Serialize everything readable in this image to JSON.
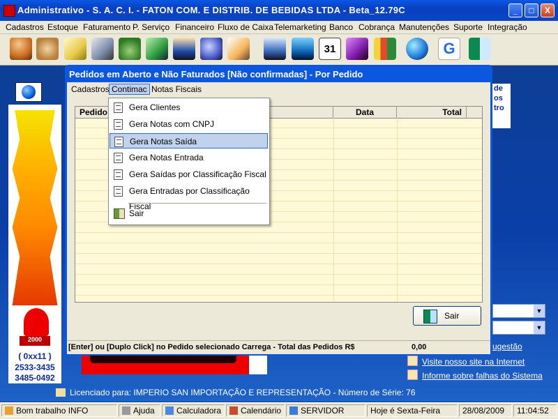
{
  "app": {
    "title": "Administrativo - S. A. C. I. - FATON COM. E DISTRIB. DE BEBIDAS LTDA - Beta_12.79C",
    "window_buttons": {
      "minimize": "_",
      "maximize": "□",
      "close": "X"
    }
  },
  "menubar": [
    "Cadastros",
    "Estoque",
    "Faturamento",
    "P. Serviço",
    "Financeiro",
    "Fluxo de Caixa",
    "Telemarketing",
    "Banco",
    "Cobrança",
    "Manutenções",
    "Suporte",
    "Integração"
  ],
  "toolbar": {
    "icons": [
      "users-icon",
      "handshake-icon",
      "notes-icon",
      "pen-icon",
      "money-bag-icon",
      "cash-icon",
      "person-icon",
      "gears-icon",
      "edit-icon",
      "terminal-icon",
      "calculator-icon",
      "calendar-icon",
      "book-icon",
      "bar-chart-icon",
      "globe-icon",
      "google-icon",
      "exit-door-icon"
    ],
    "calendar_day": "31"
  },
  "left_panel": {
    "phone_area": "( 0xx11 )",
    "phone1": "2533-3435",
    "phone2": "3485-0492",
    "badge": "2000"
  },
  "background": {
    "right_card_lines": [
      "de",
      "os",
      "",
      "tro"
    ],
    "right_links": [
      "ugestão",
      "Visite nosso site na Internet",
      "Informe sobre falhas do Sistema"
    ],
    "license": "Licenciado para: IMPERIO SAN IMPORTAÇÃO E REPRESENTAÇÃO - Número de Série: 76"
  },
  "child_window": {
    "title": "Pedidos em Aberto e Não Faturados [Não confirmadas] - Por Pedido",
    "menu": [
      "Cadastros",
      "Contimac",
      "Notas Fiscais"
    ],
    "grid_headers": {
      "pedido": "Pedido",
      "data": "Data",
      "total": "Total"
    },
    "sair_button": "Sair",
    "status_text": "[Enter] ou [Duplo Click] no Pedido selecionado Carrega - Total das Pedidos R$",
    "status_total": "0,00"
  },
  "dropdown": {
    "items": [
      "Gera Clientes",
      "Gera Notas com CNPJ",
      "Gera Notas Saída",
      "Gera Notas Entrada",
      "Gera Saídas por Classificação Fiscal",
      "Gera Entradas por Classificação Fiscal"
    ],
    "highlighted": "Gera Notas Saída",
    "exit_label": "Sair"
  },
  "statusbar": {
    "status": "Bom trabalho INFO",
    "help": "Ajuda",
    "calculator": "Calculadora",
    "calendar": "Calendário",
    "server": "SERVIDOR",
    "weekday": "Hoje é Sexta-Feira",
    "date": "28/08/2009",
    "time": "11:04:52"
  }
}
